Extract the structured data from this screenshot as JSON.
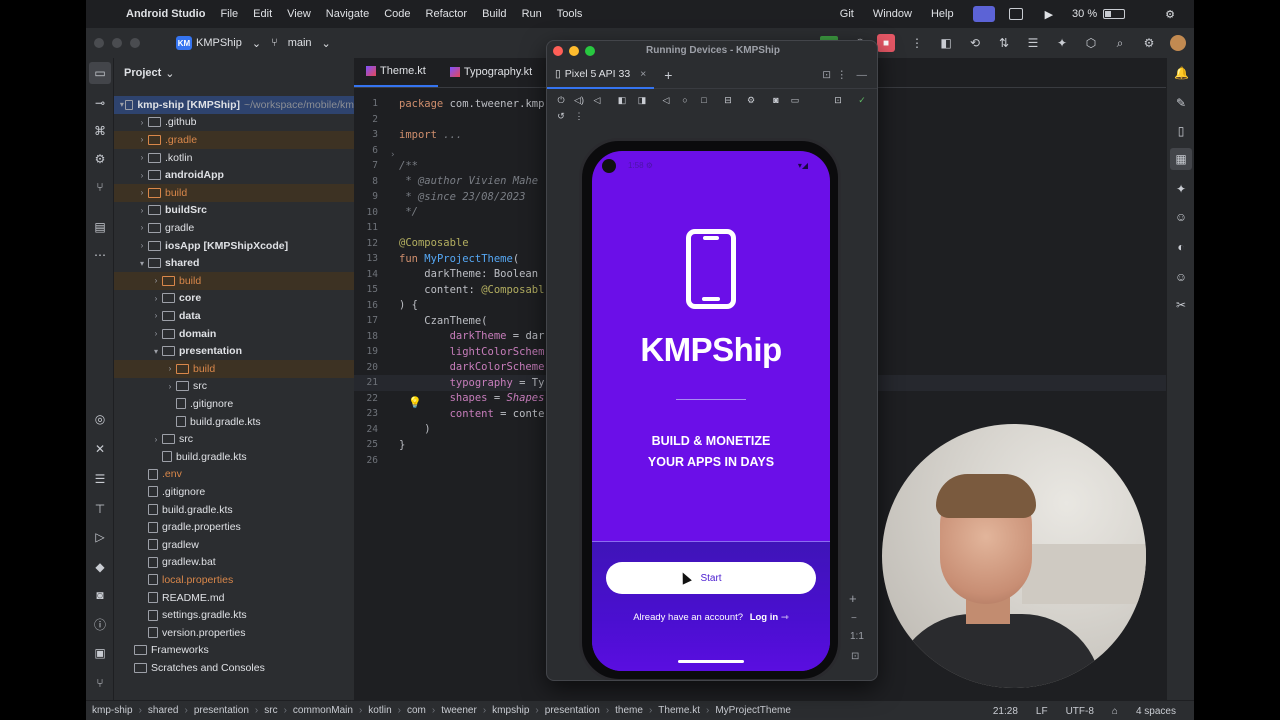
{
  "menubar": {
    "app_name": "Android Studio",
    "items": [
      "File",
      "Edit",
      "View",
      "Navigate",
      "Code",
      "Refactor",
      "Build",
      "Run",
      "Tools"
    ],
    "right_items": [
      "Git",
      "Window",
      "Help"
    ],
    "battery_text": "30 %"
  },
  "toolbar": {
    "project_badge": "KM",
    "project_name": "KMPShip",
    "branch": "main"
  },
  "project_panel": {
    "title": "Project",
    "rows": [
      {
        "label": "kmp-ship [KMPShip]",
        "suffix": "~/workspace/mobile/km",
        "indent": 0,
        "arrow": "down",
        "type": "folder",
        "style": "bold",
        "state": "selected"
      },
      {
        "label": ".github",
        "indent": 1,
        "arrow": "right",
        "type": "folder"
      },
      {
        "label": ".gradle",
        "indent": 1,
        "arrow": "right",
        "type": "folder",
        "style": "orange",
        "state": "excluded"
      },
      {
        "label": ".kotlin",
        "indent": 1,
        "arrow": "right",
        "type": "folder"
      },
      {
        "label": "androidApp",
        "indent": 1,
        "arrow": "right",
        "type": "folder",
        "style": "bold"
      },
      {
        "label": "build",
        "indent": 1,
        "arrow": "right",
        "type": "folder",
        "style": "orange",
        "state": "excluded"
      },
      {
        "label": "buildSrc",
        "indent": 1,
        "arrow": "right",
        "type": "folder",
        "style": "bold"
      },
      {
        "label": "gradle",
        "indent": 1,
        "arrow": "right",
        "type": "folder"
      },
      {
        "label": "iosApp [KMPShipXcode]",
        "indent": 1,
        "arrow": "right",
        "type": "folder",
        "style": "bold"
      },
      {
        "label": "shared",
        "indent": 1,
        "arrow": "down",
        "type": "folder",
        "style": "bold"
      },
      {
        "label": "build",
        "indent": 2,
        "arrow": "right",
        "type": "folder",
        "style": "orange",
        "state": "excluded"
      },
      {
        "label": "core",
        "indent": 2,
        "arrow": "right",
        "type": "folder",
        "style": "bold"
      },
      {
        "label": "data",
        "indent": 2,
        "arrow": "right",
        "type": "folder",
        "style": "bold"
      },
      {
        "label": "domain",
        "indent": 2,
        "arrow": "right",
        "type": "folder",
        "style": "bold"
      },
      {
        "label": "presentation",
        "indent": 2,
        "arrow": "down",
        "type": "folder",
        "style": "bold"
      },
      {
        "label": "build",
        "indent": 3,
        "arrow": "right",
        "type": "folder",
        "style": "orange",
        "state": "excluded"
      },
      {
        "label": "src",
        "indent": 3,
        "arrow": "right",
        "type": "folder"
      },
      {
        "label": ".gitignore",
        "indent": 3,
        "arrow": "",
        "type": "file"
      },
      {
        "label": "build.gradle.kts",
        "indent": 3,
        "arrow": "",
        "type": "file"
      },
      {
        "label": "src",
        "indent": 2,
        "arrow": "right",
        "type": "folder"
      },
      {
        "label": "build.gradle.kts",
        "indent": 2,
        "arrow": "",
        "type": "file"
      },
      {
        "label": ".env",
        "indent": 1,
        "arrow": "",
        "type": "file",
        "style": "orange"
      },
      {
        "label": ".gitignore",
        "indent": 1,
        "arrow": "",
        "type": "file"
      },
      {
        "label": "build.gradle.kts",
        "indent": 1,
        "arrow": "",
        "type": "file"
      },
      {
        "label": "gradle.properties",
        "indent": 1,
        "arrow": "",
        "type": "file"
      },
      {
        "label": "gradlew",
        "indent": 1,
        "arrow": "",
        "type": "file"
      },
      {
        "label": "gradlew.bat",
        "indent": 1,
        "arrow": "",
        "type": "file"
      },
      {
        "label": "local.properties",
        "indent": 1,
        "arrow": "",
        "type": "file",
        "style": "orange"
      },
      {
        "label": "README.md",
        "indent": 1,
        "arrow": "",
        "type": "file",
        "badge": "M↓"
      },
      {
        "label": "settings.gradle.kts",
        "indent": 1,
        "arrow": "",
        "type": "file"
      },
      {
        "label": "version.properties",
        "indent": 1,
        "arrow": "",
        "type": "file"
      },
      {
        "label": "Frameworks",
        "indent": 0,
        "arrow": "",
        "type": "folder"
      },
      {
        "label": "Scratches and Consoles",
        "indent": 0,
        "arrow": "",
        "type": "folder"
      }
    ]
  },
  "editor": {
    "tabs": [
      {
        "label": "Theme.kt",
        "active": true
      },
      {
        "label": "Typography.kt",
        "active": false
      }
    ],
    "lines": [
      {
        "n": "1",
        "html": "<span class='kw'>package</span> com.tweener.kmp"
      },
      {
        "n": "2",
        "html": ""
      },
      {
        "n": "3",
        "html": "<span class='kw'>import</span> <span class='cm'>...</span>"
      },
      {
        "n": "6",
        "html": ""
      },
      {
        "n": "7",
        "html": "<span class='cm'>/**</span>"
      },
      {
        "n": "8",
        "html": "<span class='cm'> * @author Vivien Mahe</span>"
      },
      {
        "n": "9",
        "html": "<span class='cm'> * @since 23/08/2023</span>"
      },
      {
        "n": "10",
        "html": "<span class='cm'> */</span>"
      },
      {
        "n": "11",
        "html": ""
      },
      {
        "n": "12",
        "html": "<span class='an'>@Composable</span>"
      },
      {
        "n": "13",
        "html": "<span class='kw'>fun</span> <span class='fn'>MyProjectTheme</span>("
      },
      {
        "n": "14",
        "html": "    darkTheme: Boolean"
      },
      {
        "n": "15",
        "html": "    content: <span class='an'>@Composabl</span>"
      },
      {
        "n": "16",
        "html": ") {"
      },
      {
        "n": "17",
        "html": "    CzanTheme("
      },
      {
        "n": "18",
        "html": "        <span class='id'>darkTheme</span> = dar"
      },
      {
        "n": "19",
        "html": "        <span class='id'>lightColorSchem</span>"
      },
      {
        "n": "20",
        "html": "        <span class='id'>darkColorScheme</span>"
      },
      {
        "n": "21",
        "html": "        <span class='id'>typography</span> = Ty"
      },
      {
        "n": "22",
        "html": "        <span class='id'>shapes</span> = <span class='it'>Shapes</span>"
      },
      {
        "n": "23",
        "html": "        <span class='id'>content</span> = conte"
      },
      {
        "n": "24",
        "html": "    )"
      },
      {
        "n": "25",
        "html": "}"
      },
      {
        "n": "26",
        "html": ""
      }
    ]
  },
  "devices_window": {
    "title": "Running Devices - KMPShip",
    "device_tab": "Pixel 5 API 33",
    "zoom_label": "1:1"
  },
  "app_screen": {
    "title": "KMPShip",
    "tagline_line1": "BUILD & MONETIZE",
    "tagline_line2": "YOUR APPS IN DAYS",
    "start_button": "Start",
    "login_prompt": "Already have an account?",
    "login_link": "Log in"
  },
  "statusbar": {
    "breadcrumbs": [
      "kmp-ship",
      "shared",
      "presentation",
      "src",
      "commonMain",
      "kotlin",
      "com",
      "tweener",
      "kmpship",
      "presentation",
      "theme",
      "Theme.kt",
      "MyProjectTheme"
    ],
    "position": "21:28",
    "line_ending": "LF",
    "encoding": "UTF-8",
    "indent": "4 spaces"
  }
}
